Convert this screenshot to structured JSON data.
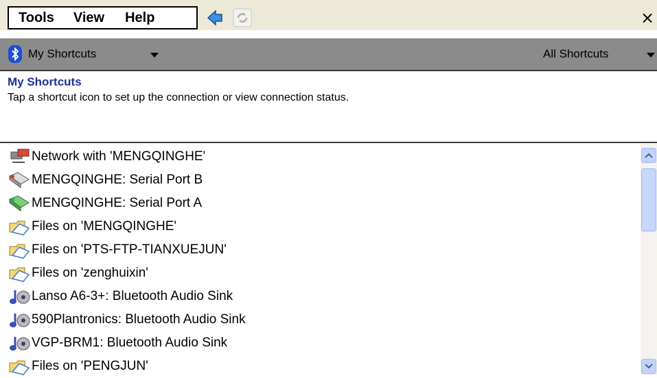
{
  "menubar": {
    "items": [
      {
        "label": "Tools"
      },
      {
        "label": "View"
      },
      {
        "label": "Help"
      }
    ],
    "close_label": "×"
  },
  "shortcut_bar": {
    "current": "My Shortcuts",
    "filter": "All Shortcuts"
  },
  "heading": "My Shortcuts",
  "description": "Tap a shortcut icon to set up the connection or view connection status.",
  "shortcuts": [
    {
      "label": "Network with 'MENGQINGHE'",
      "icon": "network-icon"
    },
    {
      "label": "MENGQINGHE: Serial Port B",
      "icon": "serial-port-icon"
    },
    {
      "label": "MENGQINGHE: Serial Port A",
      "icon": "serial-port-active-icon"
    },
    {
      "label": "Files on 'MENGQINGHE'",
      "icon": "folder-icon"
    },
    {
      "label": "Files on 'PTS-FTP-TIANXUEJUN'",
      "icon": "folder-icon"
    },
    {
      "label": "Files on 'zenghuixin'",
      "icon": "folder-icon"
    },
    {
      "label": "Lanso A6-3+: Bluetooth Audio Sink",
      "icon": "audio-icon"
    },
    {
      "label": "590Plantronics: Bluetooth Audio Sink",
      "icon": "audio-icon"
    },
    {
      "label": "VGP-BRM1: Bluetooth Audio Sink",
      "icon": "audio-icon"
    },
    {
      "label": "Files on 'PENGJUN'",
      "icon": "folder-icon"
    }
  ],
  "colors": {
    "heading": "#1c2f9a",
    "toolbar": "#8b8b8b",
    "menubar": "#ece9d8"
  }
}
